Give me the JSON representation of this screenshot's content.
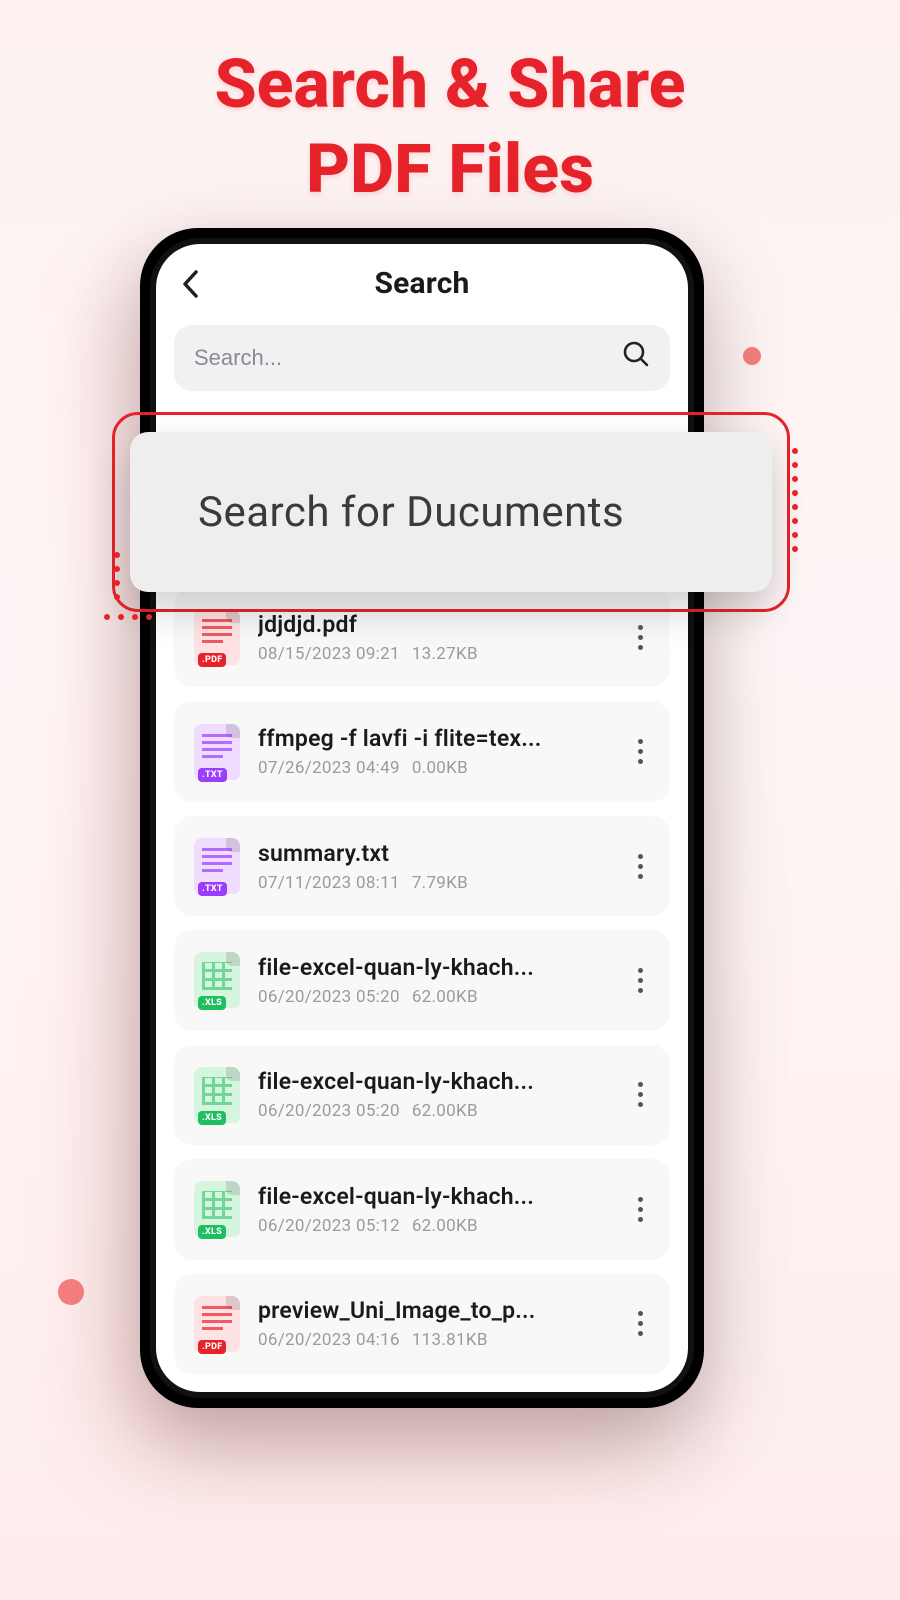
{
  "promo": {
    "line1": "Search & Share",
    "line2": "PDF Files"
  },
  "header": {
    "title": "Search"
  },
  "search": {
    "placeholder": "Search..."
  },
  "callout": {
    "text": "Search for Ducuments"
  },
  "files": [
    {
      "name": "jdjdjd.pdf",
      "date": "08/15/2023 09:21",
      "size": "13.27KB",
      "type": "pdf",
      "tag": ".PDF"
    },
    {
      "name": "ffmpeg -f lavfi -i flite=tex...",
      "date": "07/26/2023 04:49",
      "size": "0.00KB",
      "type": "txt",
      "tag": ".TXT"
    },
    {
      "name": "summary.txt",
      "date": "07/11/2023 08:11",
      "size": "7.79KB",
      "type": "txt",
      "tag": ".TXT"
    },
    {
      "name": "file-excel-quan-ly-khach...",
      "date": "06/20/2023 05:20",
      "size": "62.00KB",
      "type": "xls",
      "tag": ".XLS"
    },
    {
      "name": "file-excel-quan-ly-khach...",
      "date": "06/20/2023 05:20",
      "size": "62.00KB",
      "type": "xls",
      "tag": ".XLS"
    },
    {
      "name": "file-excel-quan-ly-khach...",
      "date": "06/20/2023 05:12",
      "size": "62.00KB",
      "type": "xls",
      "tag": ".XLS"
    },
    {
      "name": "preview_Uni_Image_to_p...",
      "date": "06/20/2023 04:16",
      "size": "113.81KB",
      "type": "pdf",
      "tag": ".PDF"
    }
  ]
}
